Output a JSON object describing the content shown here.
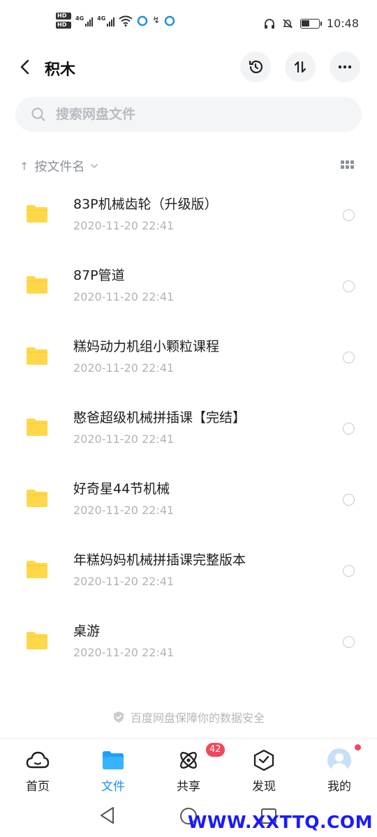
{
  "status_bar": {
    "hd1": "HD",
    "hd2": "HD",
    "net1": "4G",
    "net2": "4G",
    "time": "10:48"
  },
  "header": {
    "title": "积木"
  },
  "search": {
    "placeholder": "搜索网盘文件"
  },
  "sort": {
    "label": "按文件名"
  },
  "files": [
    {
      "name": "83P机械齿轮（升级版）",
      "date": "2020-11-20  22:41"
    },
    {
      "name": "87P管道",
      "date": "2020-11-20  22:41"
    },
    {
      "name": "糕妈动力机组小颗粒课程",
      "date": "2020-11-20  22:41"
    },
    {
      "name": "憨爸超级机械拼插课【完结】",
      "date": "2020-11-20  22:41"
    },
    {
      "name": "好奇星44节机械",
      "date": "2020-11-20  22:41"
    },
    {
      "name": "年糕妈妈机械拼插课完整版本",
      "date": "2020-11-20  22:41"
    },
    {
      "name": "桌游",
      "date": "2020-11-20  22:41"
    }
  ],
  "footer_note": "百度网盘保障你的数据安全",
  "tabs": [
    {
      "label": "首页",
      "icon": "cloud-icon"
    },
    {
      "label": "文件",
      "icon": "folder-icon",
      "active": true
    },
    {
      "label": "共享",
      "icon": "atom-icon",
      "badge": "42"
    },
    {
      "label": "发现",
      "icon": "cube-icon"
    },
    {
      "label": "我的",
      "icon": "avatar-icon",
      "dot": true
    }
  ],
  "watermark": "WWW.XXTTQ.COM",
  "colors": {
    "accent": "#1a8cff",
    "folder": "#ffd84a",
    "badge": "#f5455c"
  }
}
